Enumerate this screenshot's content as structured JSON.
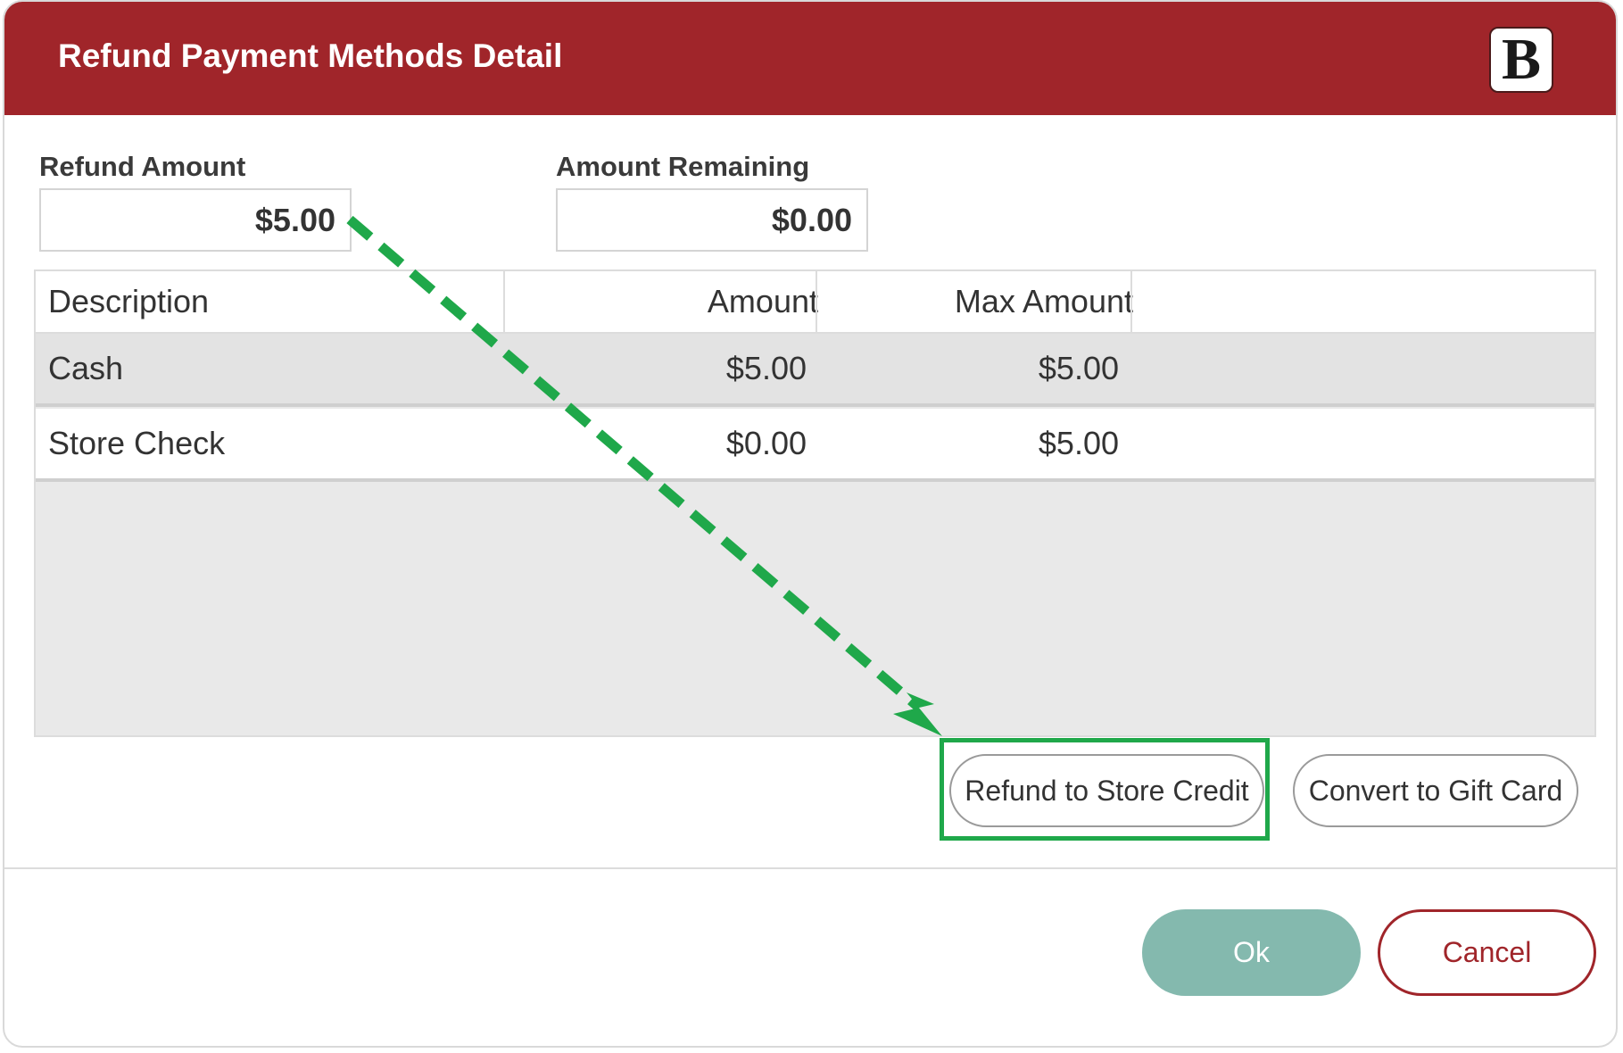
{
  "dialog": {
    "title": "Refund Payment Methods Detail",
    "logo_letter": "B"
  },
  "fields": {
    "refund_amount_label": "Refund Amount",
    "refund_amount_value": "$5.00",
    "amount_remaining_label": "Amount Remaining",
    "amount_remaining_value": "$0.00"
  },
  "grid": {
    "columns": [
      "Description",
      "Amount",
      "Max Amount"
    ],
    "rows": [
      {
        "description": "Cash",
        "amount": "$5.00",
        "max_amount": "$5.00",
        "selected": true
      },
      {
        "description": "Store Check",
        "amount": "$0.00",
        "max_amount": "$5.00",
        "selected": false
      }
    ]
  },
  "actions": {
    "refund_store_credit_label": "Refund to Store Credit",
    "convert_gift_card_label": "Convert to Gift Card"
  },
  "footer": {
    "ok_label": "Ok",
    "cancel_label": "Cancel"
  },
  "colors": {
    "header_bg": "#a0252a",
    "ok_bg": "#84b9ae",
    "annotation": "#1fa84a"
  },
  "icons": {
    "logo": "brand-logo-icon",
    "arrow": "dashed-arrow-annotation"
  }
}
